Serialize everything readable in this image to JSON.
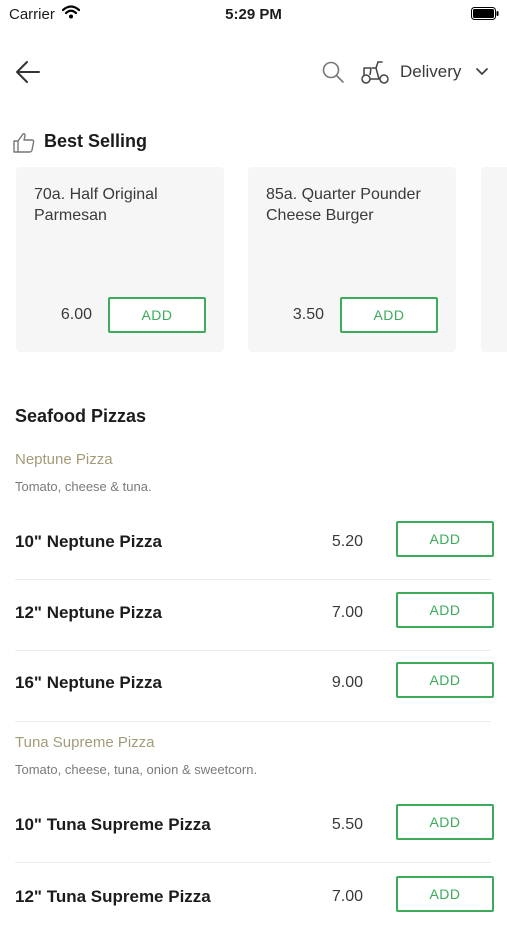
{
  "status_bar": {
    "carrier": "Carrier",
    "time": "5:29 PM"
  },
  "nav": {
    "delivery_label": "Delivery"
  },
  "best_selling": {
    "title": "Best Selling",
    "cards": [
      {
        "name": "70a. Half Original Parmesan",
        "price": "6.00",
        "add_label": "ADD"
      },
      {
        "name": "85a. Quarter Pounder Cheese Burger",
        "price": "3.50",
        "add_label": "ADD"
      }
    ]
  },
  "menu": {
    "section_title": "Seafood Pizzas",
    "groups": [
      {
        "name": "Neptune Pizza",
        "description": "Tomato, cheese & tuna.",
        "items": [
          {
            "name": "10\" Neptune Pizza",
            "price": "5.20",
            "add_label": "ADD"
          },
          {
            "name": "12\" Neptune Pizza",
            "price": "7.00",
            "add_label": "ADD"
          },
          {
            "name": "16\" Neptune Pizza",
            "price": "9.00",
            "add_label": "ADD"
          }
        ]
      },
      {
        "name": "Tuna Supreme Pizza",
        "description": "Tomato, cheese, tuna, onion & sweetcorn.",
        "items": [
          {
            "name": "10\" Tuna Supreme Pizza",
            "price": "5.50",
            "add_label": "ADD"
          },
          {
            "name": "12\" Tuna Supreme Pizza",
            "price": "7.00",
            "add_label": "ADD"
          }
        ]
      }
    ]
  },
  "colors": {
    "accent": "#3cab5a",
    "group_name": "#a39c7a",
    "card_bg": "#f6f6f6"
  },
  "icons": [
    "wifi-icon",
    "battery-icon",
    "back-arrow-icon",
    "search-icon",
    "scooter-icon",
    "chevron-down-icon",
    "thumbs-up-icon"
  ]
}
